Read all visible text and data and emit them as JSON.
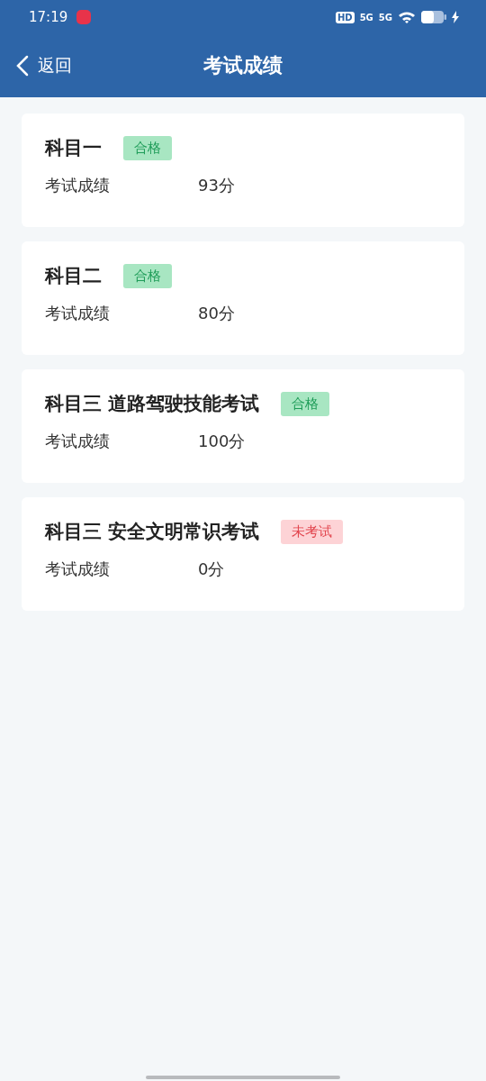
{
  "status_bar": {
    "time": "17:19",
    "hd": "HD",
    "networks": [
      "5G",
      "5G"
    ]
  },
  "nav": {
    "back": "返回",
    "title": "考试成绩"
  },
  "results": [
    {
      "subject": "科目一",
      "status": {
        "kind": "passed",
        "label": "合格"
      },
      "score_label": "考试成绩",
      "score": "93分"
    },
    {
      "subject": "科目二",
      "status": {
        "kind": "passed",
        "label": "合格"
      },
      "score_label": "考试成绩",
      "score": "80分"
    },
    {
      "subject": "科目三 道路驾驶技能考试",
      "status": {
        "kind": "passed",
        "label": "合格"
      },
      "score_label": "考试成绩",
      "score": "100分"
    },
    {
      "subject": "科目三 安全文明常识考试",
      "status": {
        "kind": "not_taken",
        "label": "未考试"
      },
      "score_label": "考试成绩",
      "score": "0分"
    }
  ]
}
